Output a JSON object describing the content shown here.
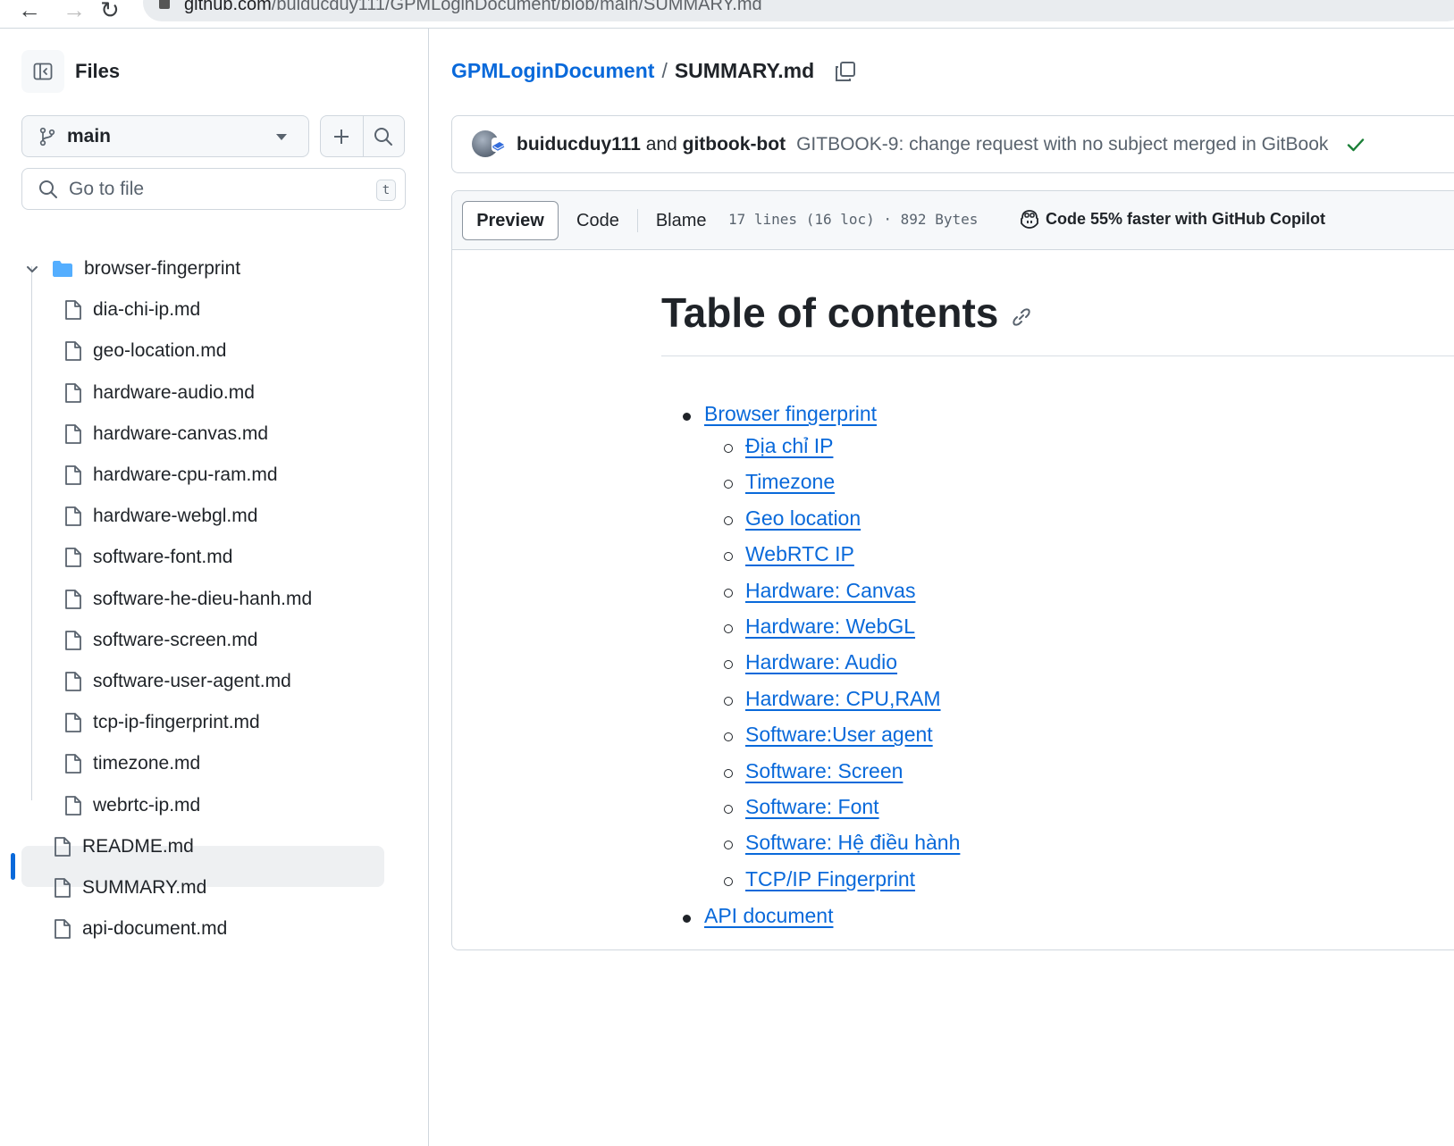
{
  "browser": {
    "url_host": "github.com",
    "url_path": "/buiducduy111/GPMLoginDocument/blob/main/SUMMARY.md"
  },
  "sidebar": {
    "title": "Files",
    "branch": "main",
    "search_placeholder": "Go to file",
    "search_shortcut": "t",
    "folder": "browser-fingerprint",
    "folder_files": [
      "dia-chi-ip.md",
      "geo-location.md",
      "hardware-audio.md",
      "hardware-canvas.md",
      "hardware-cpu-ram.md",
      "hardware-webgl.md",
      "software-font.md",
      "software-he-dieu-hanh.md",
      "software-screen.md",
      "software-user-agent.md",
      "tcp-ip-fingerprint.md",
      "timezone.md",
      "webrtc-ip.md"
    ],
    "root_files": [
      "README.md",
      "SUMMARY.md",
      "api-document.md"
    ],
    "selected_file": "SUMMARY.md"
  },
  "breadcrumb": {
    "repo": "GPMLoginDocument",
    "separator": "/",
    "file": "SUMMARY.md"
  },
  "commit": {
    "author1": "buiducduy111",
    "conj": "and",
    "author2": "gitbook-bot",
    "message": "GITBOOK-9: change request with no subject merged in GitBook",
    "status": "success"
  },
  "file_header": {
    "tabs": [
      "Preview",
      "Code",
      "Blame"
    ],
    "active_tab": "Preview",
    "meta": "17 lines (16 loc) · 892 Bytes",
    "copilot": "Code 55% faster with GitHub Copilot"
  },
  "content": {
    "heading": "Table of contents",
    "items": [
      {
        "label": "Browser fingerprint",
        "children": [
          "Địa chỉ IP",
          "Timezone",
          "Geo location",
          "WebRTC IP",
          "Hardware: Canvas",
          "Hardware: WebGL",
          "Hardware: Audio",
          "Hardware: CPU,RAM",
          "Software:User agent",
          "Software: Screen",
          "Software: Font",
          "Software: Hệ điều hành",
          "TCP/IP Fingerprint"
        ]
      },
      {
        "label": "API document",
        "children": []
      }
    ]
  },
  "colors": {
    "accent": "#0969da",
    "success": "#1a7f37",
    "border": "#d0d7de",
    "text": "#1f2328",
    "muted": "#59636e",
    "folder": "#54aeff"
  }
}
